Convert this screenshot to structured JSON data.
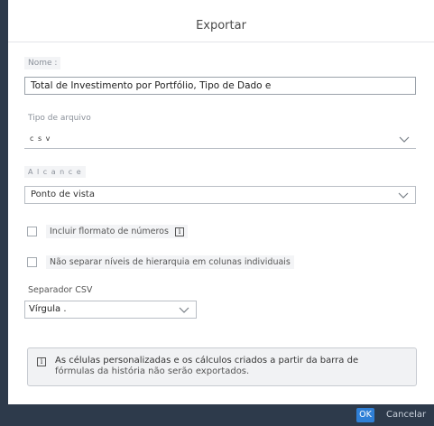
{
  "dialog": {
    "title": "Exportar"
  },
  "name": {
    "label": "Nome :",
    "value": "Total de Investimento por Portfólio, Tipo de Dado e"
  },
  "file_type": {
    "label": "Tipo  de arquivo",
    "value": "c s v"
  },
  "scope": {
    "label": "A l c a n c e",
    "value": "Ponto de vista"
  },
  "options": {
    "include_number_format": "Incluir  flormato  de  números",
    "no_separate_hierarchy": "Não separar níveis de hierarquia em colunas individuais"
  },
  "separator": {
    "label": "Separador  CSV",
    "value": "Vírgula ."
  },
  "info": {
    "line1": "As células personalizadas e os cálculos criados a partir da barra de",
    "line2": "fórmulas da história não serão exportados."
  },
  "footer": {
    "ok_label": "OK",
    "cancel_label": "Cancelar"
  },
  "colors": {
    "footer_bg": "#2d3a4b",
    "ok_bg": "#2f7fd6"
  }
}
